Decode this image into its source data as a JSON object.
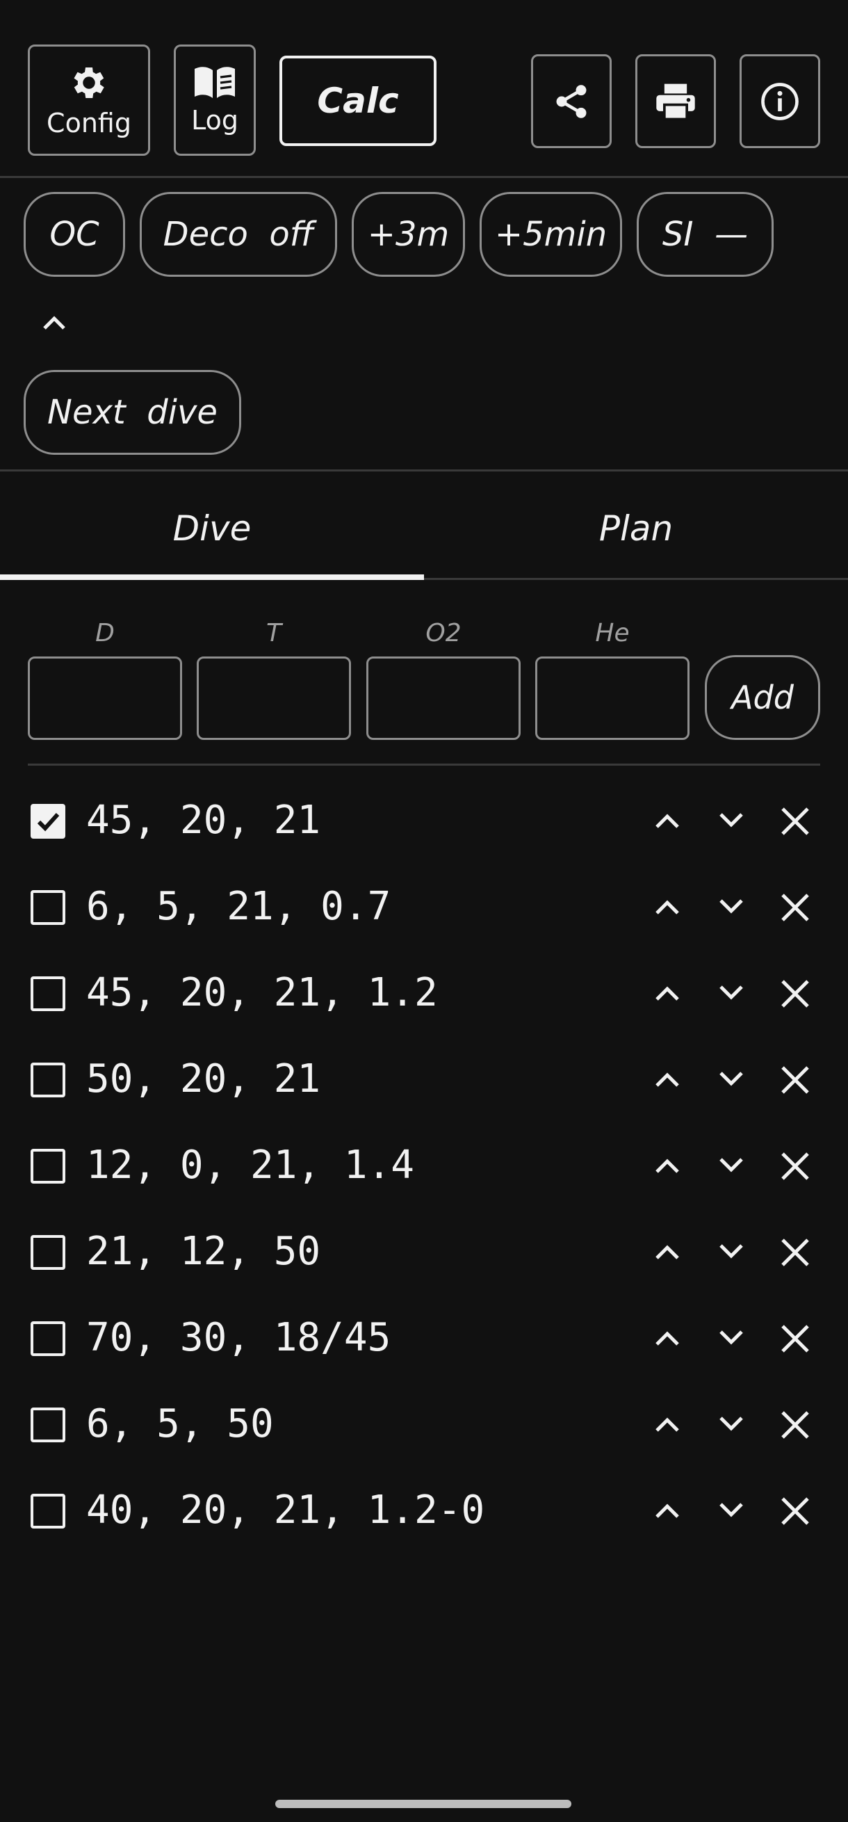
{
  "toolbar": {
    "config_label": "Config",
    "log_label": "Log",
    "calc_label": "Calc"
  },
  "chips": {
    "mode": "OC",
    "deco": "Deco  off",
    "plus_depth": "+3m",
    "plus_time": "+5min",
    "si": "SI  —",
    "next_dive": "Next  dive"
  },
  "tabs": {
    "dive": "Dive",
    "plan": "Plan"
  },
  "form": {
    "depth_label": "D",
    "time_label": "T",
    "o2_label": "O2",
    "he_label": "He",
    "depth_value": "",
    "time_value": "",
    "o2_value": "",
    "he_value": "",
    "add_label": "Add"
  },
  "segments": [
    {
      "text": "45, 20, 21",
      "checked": true
    },
    {
      "text": "6, 5, 21, 0.7",
      "checked": false
    },
    {
      "text": "45, 20, 21, 1.2",
      "checked": false
    },
    {
      "text": "50, 20, 21",
      "checked": false
    },
    {
      "text": "12, 0, 21, 1.4",
      "checked": false
    },
    {
      "text": "21, 12, 50",
      "checked": false
    },
    {
      "text": "70, 30, 18/45",
      "checked": false
    },
    {
      "text": "6, 5, 50",
      "checked": false
    },
    {
      "text": "40, 20, 21, 1.2-0",
      "checked": false
    }
  ],
  "icons": {
    "config": "gear-icon",
    "log": "book-icon",
    "share": "share-icon",
    "print": "printer-icon",
    "info": "info-icon",
    "collapse": "chevron-up-icon",
    "move_up": "chevron-up-icon",
    "move_down": "chevron-down-icon",
    "delete": "close-icon",
    "checked": "checkbox-checked-icon",
    "unchecked": "checkbox-unchecked-icon"
  },
  "colors": {
    "background": "#111111",
    "foreground": "#f2f2f2",
    "border": "#8e8e8e",
    "muted": "#a0a0a0",
    "divider": "#3a3a3a"
  }
}
